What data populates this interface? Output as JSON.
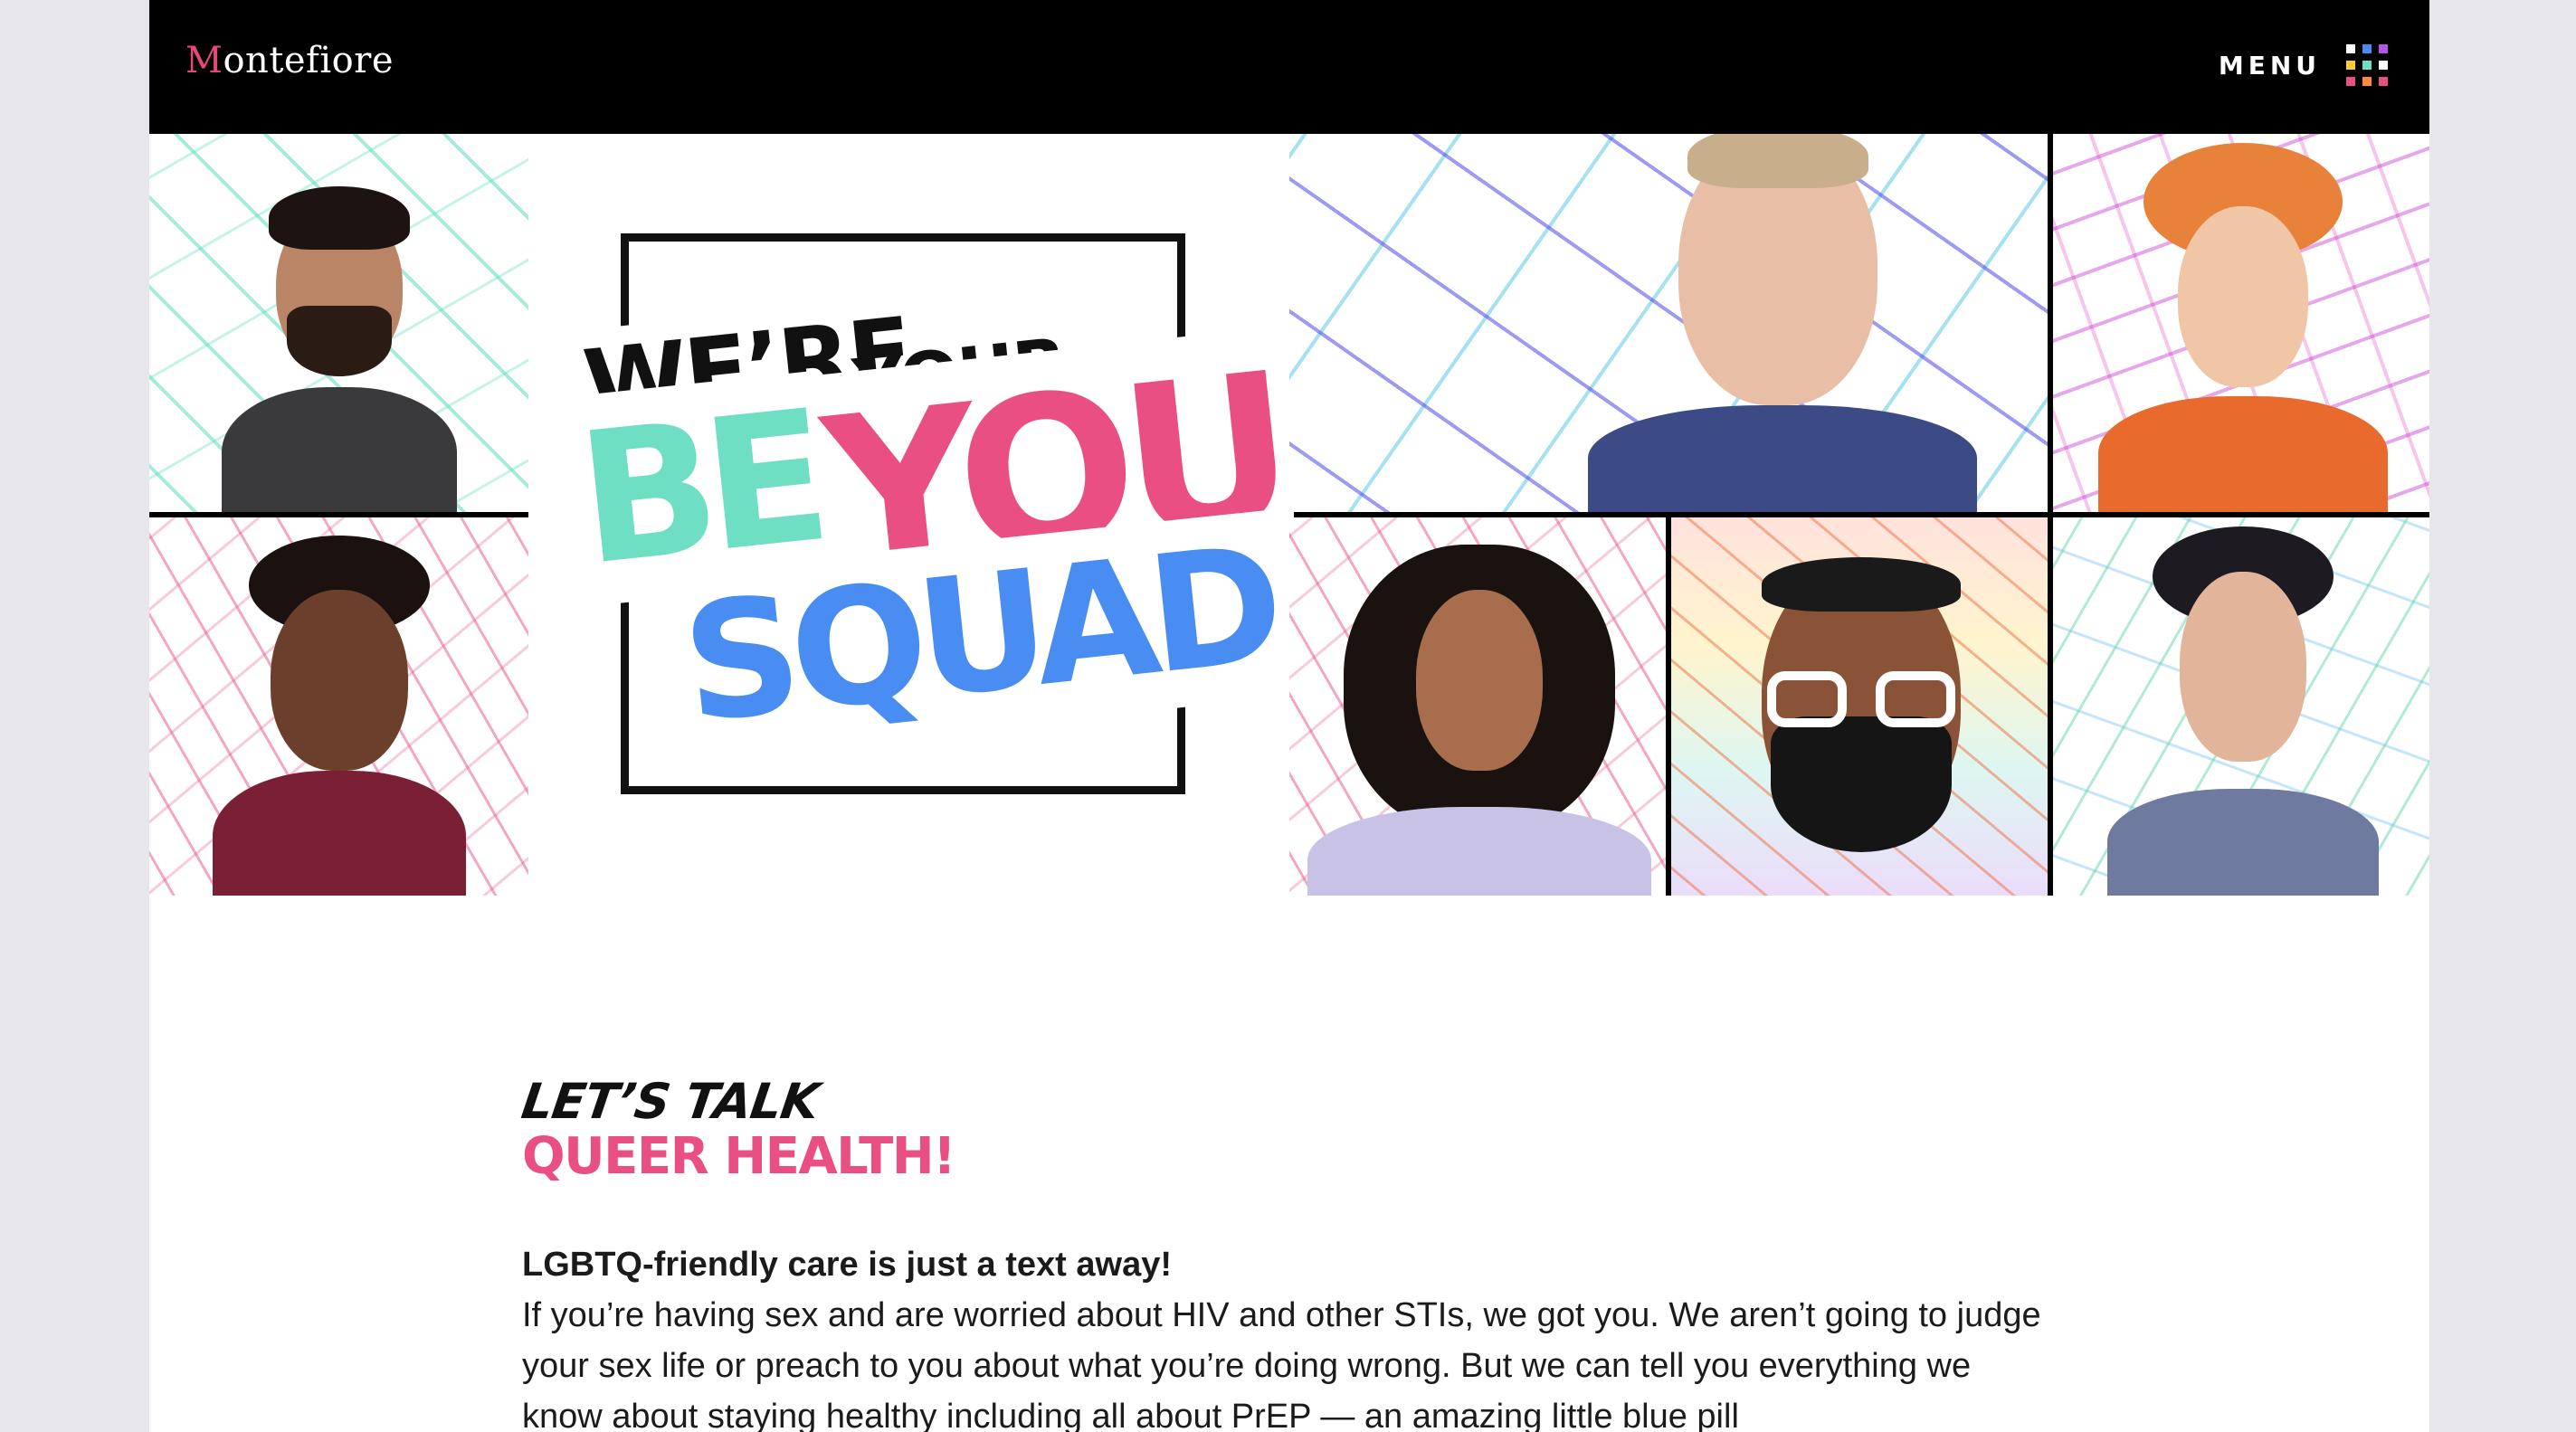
{
  "header": {
    "logo_initial": "M",
    "logo_rest": "ontefiore",
    "menu_label": "MENU",
    "menu_dot_colors": [
      "#ffffff",
      "#4a8df2",
      "#b653e8",
      "#ffcc33",
      "#6fdfc3",
      "#ffffff",
      "#ea4f83",
      "#ff8a3d",
      "#ea4f83"
    ]
  },
  "hero": {
    "title_line1": "WE’RE",
    "title_line2": "YOUR",
    "title_be": "BE",
    "title_you": "YOU",
    "title_squad": "SQUAD",
    "colors": {
      "be": "#6fdfc3",
      "you": "#ea4f83",
      "squad": "#4a8df2"
    }
  },
  "content": {
    "kicker": "LET’S TALK",
    "headline": "QUEER HEALTH!",
    "lead": "LGBTQ-friendly care is just a text away!",
    "body": "If you’re having sex and are worried about HIV and other STIs, we got you. We aren’t going to judge your sex life or preach to you about what you’re doing wrong. But we can tell you everything we know about staying healthy including all about PrEP — an amazing little blue pill"
  }
}
